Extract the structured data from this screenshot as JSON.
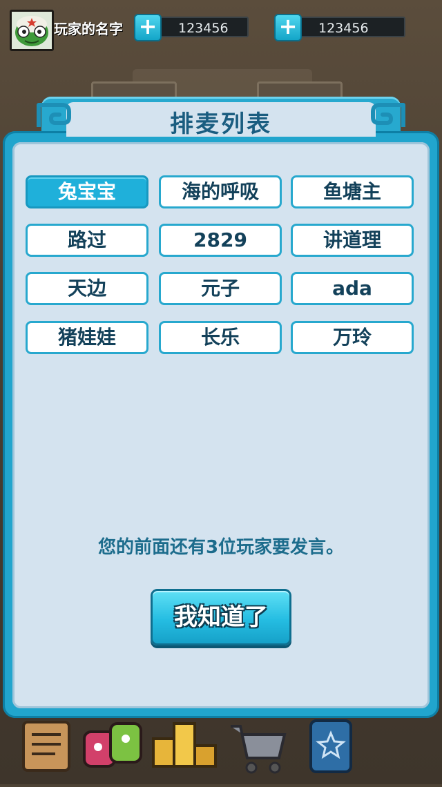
{
  "player": {
    "name": "玩家的名字",
    "avatar_icon": "frog-soldier-avatar-icon"
  },
  "currencies": [
    {
      "value": "123456",
      "add_icon": "plus-icon"
    },
    {
      "value": "123456",
      "add_icon": "plus-icon"
    }
  ],
  "dialog": {
    "title": "排麦列表",
    "names": [
      {
        "label": "兔宝宝",
        "active": true
      },
      {
        "label": "海的呼吸",
        "active": false
      },
      {
        "label": "鱼塘主",
        "active": false
      },
      {
        "label": "路过",
        "active": false
      },
      {
        "label": "2829",
        "active": false
      },
      {
        "label": "讲道理",
        "active": false
      },
      {
        "label": "天边",
        "active": false
      },
      {
        "label": "元子",
        "active": false
      },
      {
        "label": "ada",
        "active": false
      },
      {
        "label": "猪娃娃",
        "active": false
      },
      {
        "label": "长乐",
        "active": false
      },
      {
        "label": "万玲",
        "active": false
      }
    ],
    "queue_message": "您的前面还有3位玩家要发言。",
    "confirm_label": "我知道了"
  },
  "bottom_nav": [
    {
      "icon": "scroll-icon"
    },
    {
      "icon": "monsters-icon"
    },
    {
      "icon": "podium-icon"
    },
    {
      "icon": "shopping-cart-icon"
    },
    {
      "icon": "star-card-icon"
    }
  ],
  "colors": {
    "accent": "#21a5cd",
    "panel": "#d4e3ef",
    "title_text": "#1a5d80",
    "message_text": "#1c6c8c"
  }
}
